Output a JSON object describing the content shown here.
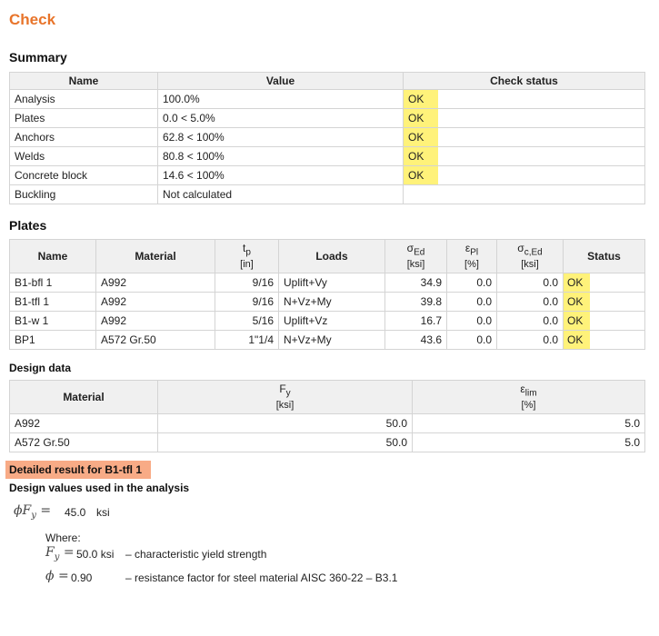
{
  "title": "Check",
  "summary": {
    "heading": "Summary",
    "headers": [
      "Name",
      "Value",
      "Check status"
    ],
    "rows": [
      {
        "name": "Analysis",
        "value": "100.0%",
        "status": "OK"
      },
      {
        "name": "Plates",
        "value": "0.0 < 5.0%",
        "status": "OK"
      },
      {
        "name": "Anchors",
        "value": "62.8 < 100%",
        "status": "OK"
      },
      {
        "name": "Welds",
        "value": "80.8 < 100%",
        "status": "OK"
      },
      {
        "name": "Concrete block",
        "value": "14.6 < 100%",
        "status": "OK"
      },
      {
        "name": "Buckling",
        "value": "Not calculated",
        "status": ""
      }
    ]
  },
  "plates": {
    "heading": "Plates",
    "headers": {
      "name": "Name",
      "material": "Material",
      "tp_sym": "t",
      "tp_sub": "p",
      "tp_unit": "[in]",
      "loads": "Loads",
      "sigma_sym": "σ",
      "sigma_sub": "Ed",
      "sigma_unit": "[ksi]",
      "eps_sym": "ε",
      "eps_sub": "Pl",
      "eps_unit": "[%]",
      "sigc_sym": "σ",
      "sigc_sub": "c,Ed",
      "sigc_unit": "[ksi]",
      "status": "Status"
    },
    "rows": [
      {
        "name": "B1-bfl 1",
        "material": "A992",
        "tp": "9/16",
        "loads": "Uplift+Vy",
        "sigma": "34.9",
        "eps": "0.0",
        "sigc": "0.0",
        "status": "OK"
      },
      {
        "name": "B1-tfl 1",
        "material": "A992",
        "tp": "9/16",
        "loads": "N+Vz+My",
        "sigma": "39.8",
        "eps": "0.0",
        "sigc": "0.0",
        "status": "OK"
      },
      {
        "name": "B1-w 1",
        "material": "A992",
        "tp": "5/16",
        "loads": "Uplift+Vz",
        "sigma": "16.7",
        "eps": "0.0",
        "sigc": "0.0",
        "status": "OK"
      },
      {
        "name": "BP1",
        "material": "A572 Gr.50",
        "tp": "1\"1/4",
        "loads": "N+Vz+My",
        "sigma": "43.6",
        "eps": "0.0",
        "sigc": "0.0",
        "status": "OK"
      }
    ]
  },
  "design_data": {
    "heading": "Design data",
    "headers": {
      "material": "Material",
      "fy_sym": "F",
      "fy_sub": "y",
      "fy_unit": "[ksi]",
      "elim_sym": "ε",
      "elim_sub": "lim",
      "elim_unit": "[%]"
    },
    "rows": [
      {
        "material": "A992",
        "fy": "50.0",
        "elim": "5.0"
      },
      {
        "material": "A572 Gr.50",
        "fy": "50.0",
        "elim": "5.0"
      }
    ]
  },
  "detail": {
    "badge": "Detailed result for B1-tfl 1",
    "heading": "Design values used in the analysis",
    "formula_lhs": "ϕF",
    "formula_lhs_sub": "y",
    "formula_eq": "=",
    "formula_value": "45.0",
    "formula_unit": "ksi",
    "where": "Where:",
    "defs": [
      {
        "sym": "F",
        "sub": "y",
        "eq": "=",
        "value": "50.0 ksi",
        "desc": "– characteristic yield strength"
      },
      {
        "sym": "ϕ",
        "sub": "",
        "eq": "=",
        "value": "0.90",
        "desc": "– resistance factor for steel material AISC 360-22 – B3.1"
      }
    ]
  },
  "colors": {
    "title": "#e8742a",
    "ok_highlight": "#fff27a",
    "badge": "#f8ab86"
  }
}
